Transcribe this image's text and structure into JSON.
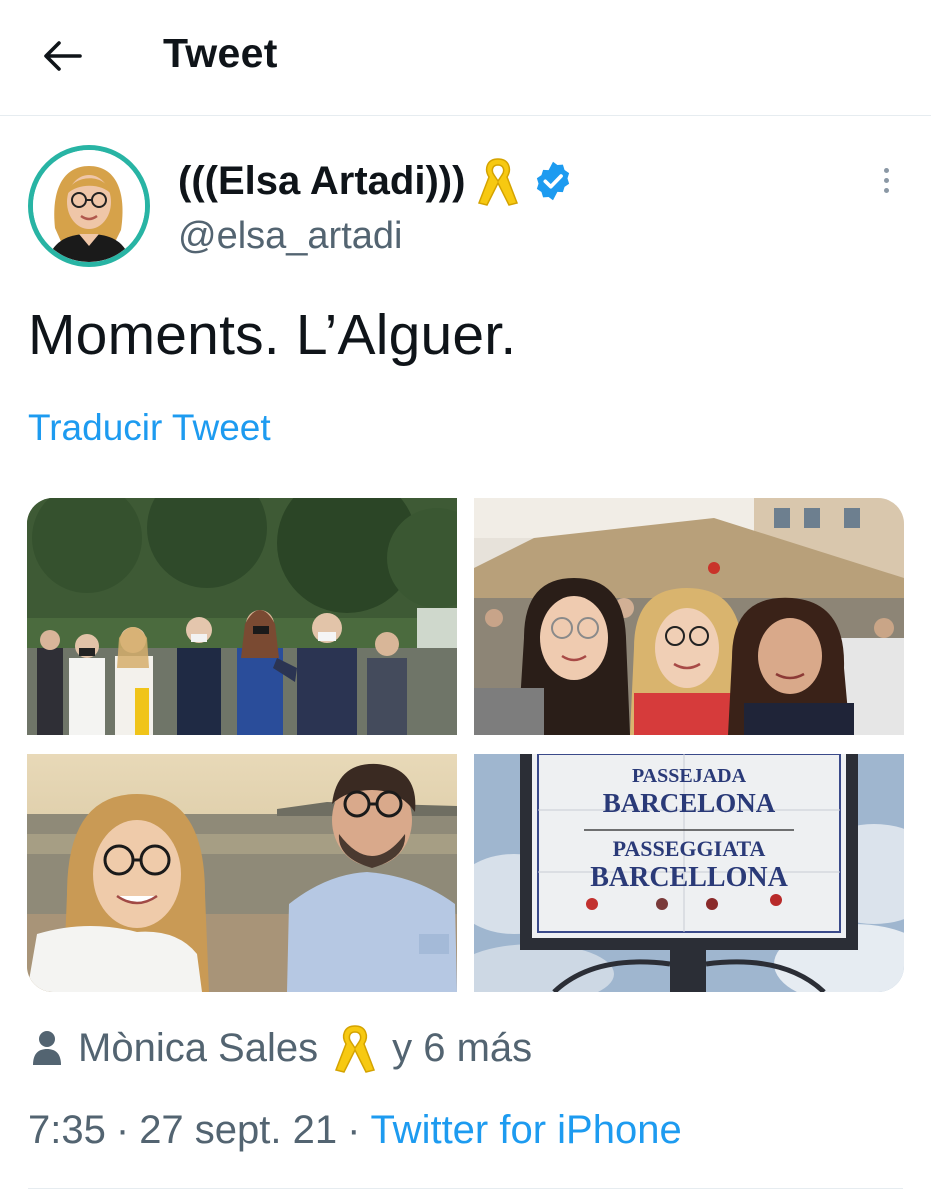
{
  "header": {
    "back_icon": "arrow-left-icon",
    "title": "Tweet"
  },
  "author": {
    "display_name": "(((Elsa Artadi)))",
    "ribbon_icon": "yellow-ribbon-icon",
    "verified_icon": "verified-badge-icon",
    "handle": "@elsa_artadi",
    "avatar_ring_color": "#28b4a4"
  },
  "tweet": {
    "text": "Moments. L’Alguer.",
    "translate_label": "Traducir Tweet"
  },
  "media": [
    {
      "sign_lines": []
    },
    {
      "sign_lines": []
    },
    {
      "sign_lines": []
    },
    {
      "sign_lines": [
        "PASSEJADA",
        "BARCELONA",
        "PASSEGGIATA",
        "BARCELLONA"
      ]
    }
  ],
  "tagged": {
    "person_icon": "person-icon",
    "name": "Mònica Sales",
    "ribbon_icon": "yellow-ribbon-icon",
    "others": "y 6 más"
  },
  "meta": {
    "time": "7:35",
    "separator": "·",
    "date": "27 sept. 21",
    "source": "Twitter for iPhone"
  },
  "colors": {
    "link": "#1d9bf0",
    "secondary_text": "#536471",
    "verified": "#1d9bf0",
    "ribbon": "#f7c911"
  }
}
